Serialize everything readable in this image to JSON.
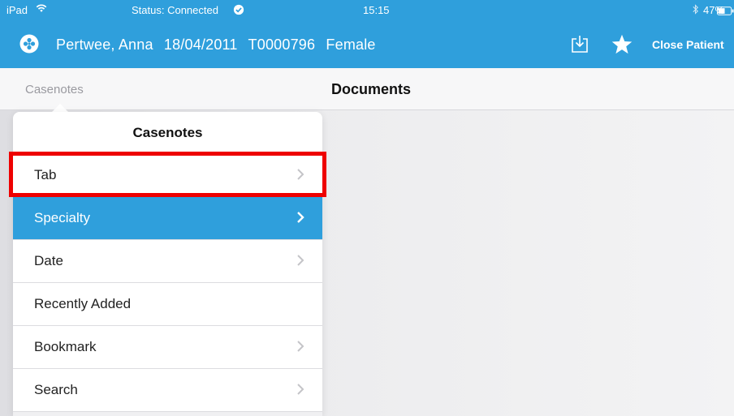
{
  "status_bar": {
    "device": "iPad",
    "connection": "Status: Connected",
    "time": "15:15",
    "battery": "47%"
  },
  "header": {
    "patient_name": "Pertwee, Anna",
    "dob": "18/04/2011",
    "patient_id": "T0000796",
    "gender": "Female",
    "close_label": "Close Patient",
    "icons": [
      "logo-icon",
      "download-icon",
      "star-icon"
    ]
  },
  "nav": {
    "back_label": "Casenotes",
    "title": "Documents"
  },
  "popover": {
    "title": "Casenotes",
    "items": [
      {
        "label": "Tab",
        "chevron": true,
        "selected": false
      },
      {
        "label": "Specialty",
        "chevron": true,
        "selected": true
      },
      {
        "label": "Date",
        "chevron": true,
        "selected": false
      },
      {
        "label": "Recently Added",
        "chevron": false,
        "selected": false
      },
      {
        "label": "Bookmark",
        "chevron": true,
        "selected": false
      },
      {
        "label": "Search",
        "chevron": true,
        "selected": false
      }
    ]
  },
  "colors": {
    "brand_blue": "#2f9fdc",
    "highlight_red": "#ee0000"
  }
}
